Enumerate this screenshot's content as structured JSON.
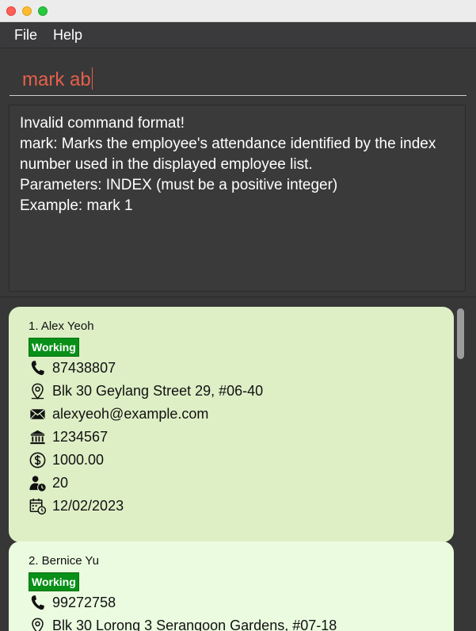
{
  "menu": {
    "file": "File",
    "help": "Help"
  },
  "command": {
    "value": "mark ab"
  },
  "result": {
    "lines": [
      "Invalid command format!",
      "mark: Marks the employee's attendance identified by the index",
      "number used in the displayed employee list.",
      "Parameters: INDEX (must be a positive integer)",
      "Example: mark 1"
    ]
  },
  "employees": [
    {
      "name": "1.  Alex Yeoh",
      "status": "Working",
      "phone": "87438807",
      "address": "Blk 30 Geylang Street 29, #06-40",
      "email": "alexyeoh@example.com",
      "bank": "1234567",
      "salary": "1000.00",
      "leave": "20",
      "date": "12/02/2023"
    },
    {
      "name": "2.  Bernice Yu",
      "status": "Working",
      "phone": "99272758",
      "address": "Blk 30 Lorong 3 Serangoon Gardens, #07-18"
    }
  ]
}
